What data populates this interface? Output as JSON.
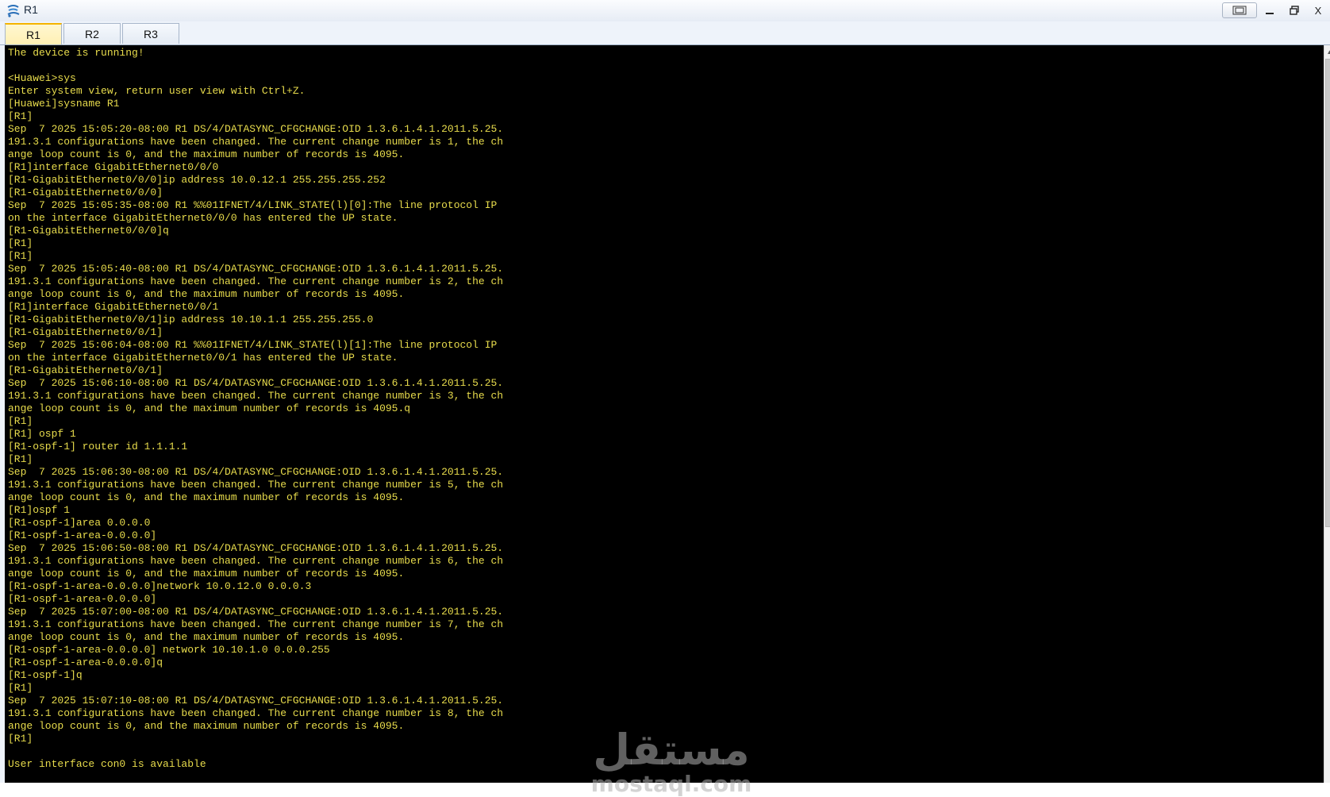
{
  "window": {
    "title": "R1",
    "controls": {
      "restore_frame": "▭",
      "minimize": "—",
      "maximize": "🗗",
      "close": "X"
    }
  },
  "tabs": [
    {
      "label": "R1",
      "active": true
    },
    {
      "label": "R2",
      "active": false
    },
    {
      "label": "R3",
      "active": false
    }
  ],
  "console": {
    "text_color": "#e8dc4c",
    "background": "#000000",
    "lines": [
      "The device is running!",
      "",
      "<Huawei>sys",
      "Enter system view, return user view with Ctrl+Z.",
      "[Huawei]sysname R1",
      "[R1]",
      "Sep  7 2025 15:05:20-08:00 R1 DS/4/DATASYNC_CFGCHANGE:OID 1.3.6.1.4.1.2011.5.25.",
      "191.3.1 configurations have been changed. The current change number is 1, the ch",
      "ange loop count is 0, and the maximum number of records is 4095.",
      "[R1]interface GigabitEthernet0/0/0",
      "[R1-GigabitEthernet0/0/0]ip address 10.0.12.1 255.255.255.252",
      "[R1-GigabitEthernet0/0/0]",
      "Sep  7 2025 15:05:35-08:00 R1 %%01IFNET/4/LINK_STATE(l)[0]:The line protocol IP",
      "on the interface GigabitEthernet0/0/0 has entered the UP state.",
      "[R1-GigabitEthernet0/0/0]q",
      "[R1]",
      "[R1]",
      "Sep  7 2025 15:05:40-08:00 R1 DS/4/DATASYNC_CFGCHANGE:OID 1.3.6.1.4.1.2011.5.25.",
      "191.3.1 configurations have been changed. The current change number is 2, the ch",
      "ange loop count is 0, and the maximum number of records is 4095.",
      "[R1]interface GigabitEthernet0/0/1",
      "[R1-GigabitEthernet0/0/1]ip address 10.10.1.1 255.255.255.0",
      "[R1-GigabitEthernet0/0/1]",
      "Sep  7 2025 15:06:04-08:00 R1 %%01IFNET/4/LINK_STATE(l)[1]:The line protocol IP",
      "on the interface GigabitEthernet0/0/1 has entered the UP state.",
      "[R1-GigabitEthernet0/0/1]",
      "Sep  7 2025 15:06:10-08:00 R1 DS/4/DATASYNC_CFGCHANGE:OID 1.3.6.1.4.1.2011.5.25.",
      "191.3.1 configurations have been changed. The current change number is 3, the ch",
      "ange loop count is 0, and the maximum number of records is 4095.q",
      "[R1]",
      "[R1] ospf 1",
      "[R1-ospf-1] router id 1.1.1.1",
      "[R1]",
      "Sep  7 2025 15:06:30-08:00 R1 DS/4/DATASYNC_CFGCHANGE:OID 1.3.6.1.4.1.2011.5.25.",
      "191.3.1 configurations have been changed. The current change number is 5, the ch",
      "ange loop count is 0, and the maximum number of records is 4095.",
      "[R1]ospf 1",
      "[R1-ospf-1]area 0.0.0.0",
      "[R1-ospf-1-area-0.0.0.0]",
      "Sep  7 2025 15:06:50-08:00 R1 DS/4/DATASYNC_CFGCHANGE:OID 1.3.6.1.4.1.2011.5.25.",
      "191.3.1 configurations have been changed. The current change number is 6, the ch",
      "ange loop count is 0, and the maximum number of records is 4095.",
      "[R1-ospf-1-area-0.0.0.0]network 10.0.12.0 0.0.0.3",
      "[R1-ospf-1-area-0.0.0.0]",
      "Sep  7 2025 15:07:00-08:00 R1 DS/4/DATASYNC_CFGCHANGE:OID 1.3.6.1.4.1.2011.5.25.",
      "191.3.1 configurations have been changed. The current change number is 7, the ch",
      "ange loop count is 0, and the maximum number of records is 4095.",
      "[R1-ospf-1-area-0.0.0.0] network 10.10.1.0 0.0.0.255",
      "[R1-ospf-1-area-0.0.0.0]q",
      "[R1-ospf-1]q",
      "[R1]",
      "Sep  7 2025 15:07:10-08:00 R1 DS/4/DATASYNC_CFGCHANGE:OID 1.3.6.1.4.1.2011.5.25.",
      "191.3.1 configurations have been changed. The current change number is 8, the ch",
      "ange loop count is 0, and the maximum number of records is 4095.",
      "[R1]",
      "",
      "User interface con0 is available"
    ]
  },
  "watermark": {
    "arabic": "مستقل",
    "latin": "mostaql.com"
  },
  "icons": {
    "app": "router-app-icon",
    "scroll_up": "scroll-up-arrow-icon"
  }
}
